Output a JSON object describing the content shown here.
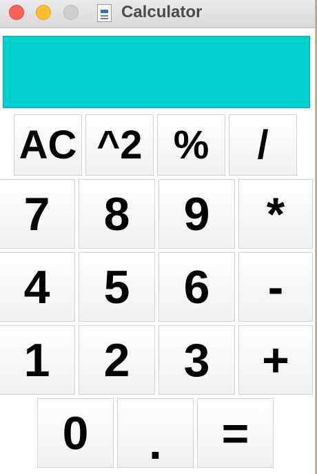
{
  "window": {
    "title": "Calculator",
    "controls": [
      "close",
      "minimize",
      "zoom"
    ]
  },
  "display": {
    "value": "",
    "color": "#00cfcf"
  },
  "keys": {
    "ac": "AC",
    "square": "^2",
    "percent": "%",
    "divide": "/",
    "seven": "7",
    "eight": "8",
    "nine": "9",
    "multiply": "*",
    "four": "4",
    "five": "5",
    "six": "6",
    "subtract": "-",
    "one": "1",
    "two": "2",
    "three": "3",
    "add": "+",
    "zero": "0",
    "decimal": ".",
    "equals": "="
  }
}
